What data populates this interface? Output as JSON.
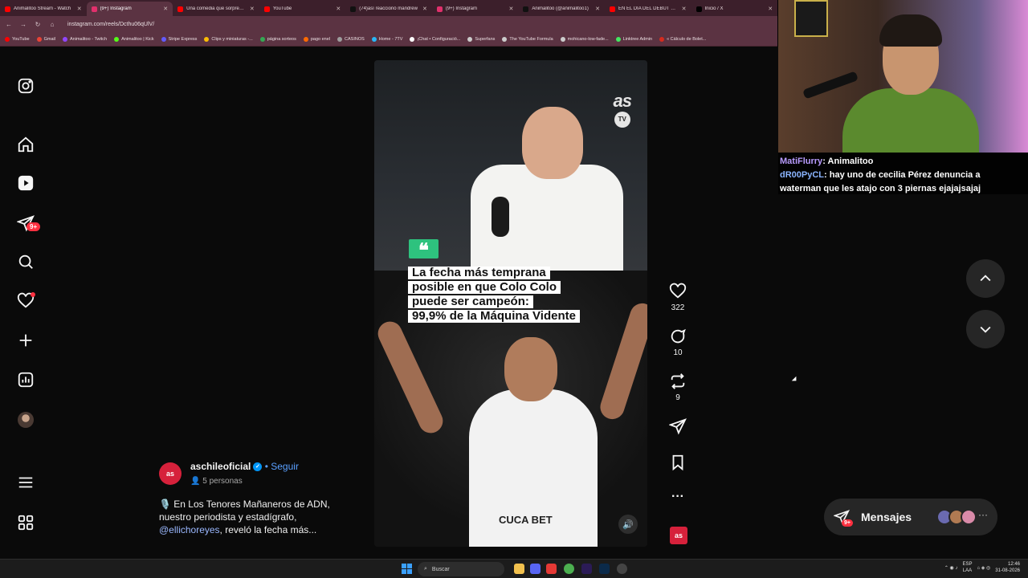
{
  "browser": {
    "tabs": [
      {
        "label": "Animalitoo Stream - Watch",
        "color": "#ff0000",
        "active": false
      },
      {
        "label": "(9+) Instagram",
        "color": "#e1306c",
        "active": true
      },
      {
        "label": "Una comedia que sorprende",
        "color": "#ff0000",
        "active": false
      },
      {
        "label": "YouTube",
        "color": "#ff0000",
        "active": false
      },
      {
        "label": "(74)así reaccionó mandrew",
        "color": "#111111",
        "active": false
      },
      {
        "label": "(9+) Instagram",
        "color": "#e1306c",
        "active": false
      },
      {
        "label": "Animalitoo (@animalitoo1)",
        "color": "#111111",
        "active": false
      },
      {
        "label": "EN EL DÍA DEL DEBUT DEL",
        "color": "#ff0000",
        "active": false
      },
      {
        "label": "Inicio / X",
        "color": "#000000",
        "active": false
      }
    ],
    "url": "instagram.com/reels/Dcthu06qUlV/",
    "bookmarks": [
      {
        "label": "YouTube",
        "color": "#ff0000"
      },
      {
        "label": "Gmail",
        "color": "#ea4335"
      },
      {
        "label": "Animalitoo - Twitch",
        "color": "#9146ff"
      },
      {
        "label": "Animalitoo | Kick",
        "color": "#53fc18"
      },
      {
        "label": "Stripe Express",
        "color": "#635bff"
      },
      {
        "label": "Clips y miniaturas -...",
        "color": "#fbbc04"
      },
      {
        "label": "página sorteos",
        "color": "#34a853"
      },
      {
        "label": "pago enel",
        "color": "#ff6a00"
      },
      {
        "label": "CASINOS",
        "color": "#9e9e9e"
      },
      {
        "label": "Home - 7TV",
        "color": "#29b6f6"
      },
      {
        "label": "¡Chat • Configuració...",
        "color": "#ffffff"
      },
      {
        "label": "Superfans",
        "color": "#cccccc"
      },
      {
        "label": "The YouTube Formula",
        "color": "#cccccc"
      },
      {
        "label": "mohicano-low-fade...",
        "color": "#cccccc"
      },
      {
        "label": "Linktree Admin",
        "color": "#43e660"
      },
      {
        "label": "« Cálculo de Bolet...",
        "color": "#d52b1e"
      }
    ]
  },
  "sidebar": {
    "home_badge": "9+"
  },
  "reel": {
    "brand_top": "as",
    "brand_tv": "TV",
    "quote_mark": "❝",
    "headline": [
      "La fecha más temprana",
      "posible en que Colo Colo",
      "puede ser campeón:",
      "99,9% de la Máquina Vidente"
    ],
    "shirt_text": "CUCA BET",
    "likes": "322",
    "comments": "10",
    "reposts": "9",
    "more": "···",
    "brand_logo": "as"
  },
  "caption": {
    "account": "aschileoficial",
    "follow": "• Seguir",
    "people": "5 personas",
    "lines": [
      "🎙️ En Los Tenores Mañaneros de ADN,",
      "nuestro periodista y estadígrafo,"
    ],
    "mention": "@ellichoreyes",
    "after_mention": ", reveló la fecha más..."
  },
  "messages": {
    "label": "Mensajes",
    "badge": "9+",
    "dots": "···"
  },
  "chat": [
    {
      "user": "MatiFlurry",
      "text": " Animalitoo"
    },
    {
      "user": "dR00PyCL",
      "text": " hay uno de cecilia Pérez denuncia a"
    },
    {
      "user": "",
      "text": "waterman que les atajo con 3 piernas ejajajsajaj"
    }
  ],
  "taskbar": {
    "search": "Buscar",
    "lang_top": "ESP",
    "lang_bottom": "LAA",
    "time": "12:46",
    "date": "31-08-2026"
  }
}
